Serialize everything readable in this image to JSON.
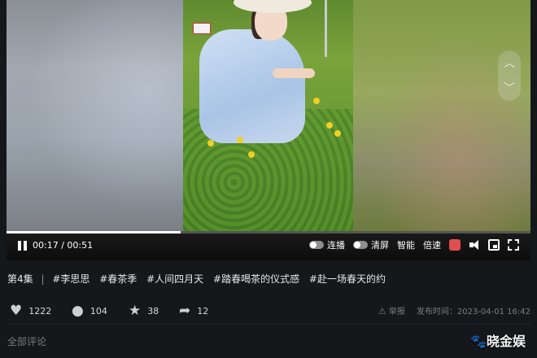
{
  "player": {
    "current_time": "00:17",
    "separator": "/",
    "duration": "00:51",
    "progress_fraction": 0.333,
    "controls": {
      "autoplay_label": "连播",
      "clear_screen_label": "清屏",
      "smart_label": "智能",
      "speed_label": "倍速"
    },
    "icons": [
      "pause-icon",
      "danmaku-icon",
      "volume-icon",
      "picture-in-picture-icon",
      "fullscreen-icon",
      "chevron-up-icon",
      "chevron-down-icon"
    ]
  },
  "video": {
    "episode": "第4集",
    "divider": "|",
    "tags": [
      "#李思思",
      "#春茶季",
      "#人间四月天",
      "#踏春喝茶的仪式感",
      "#赴一场春天的约"
    ]
  },
  "actions": {
    "likes": "1222",
    "comments": "104",
    "favorites": "38",
    "shares": "12"
  },
  "meta": {
    "report_label": "举报",
    "publish_label": "发布时间：",
    "publish_time": "2023-04-01 16:42"
  },
  "comments": {
    "title": "全部评论"
  },
  "watermark": {
    "text": "晓金娱"
  },
  "colors": {
    "background": "#16171b",
    "danmaku_accent": "#e24d4d",
    "flower_yellow": "#f1cf24"
  }
}
